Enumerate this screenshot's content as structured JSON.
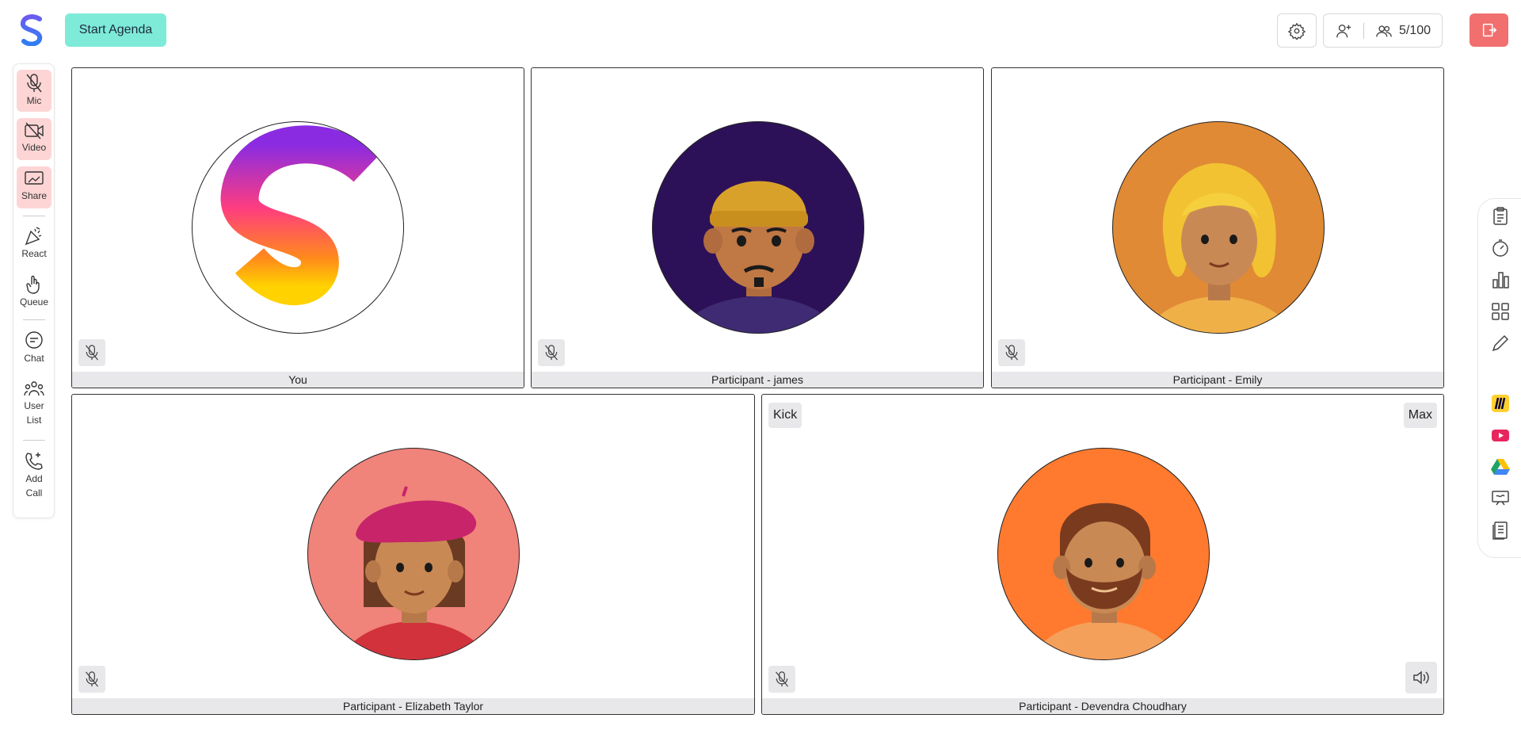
{
  "header": {
    "start_agenda_label": "Start Agenda",
    "participant_count": "5/100"
  },
  "sidebar": {
    "items": [
      {
        "label": "Mic",
        "icon": "mic-off-icon"
      },
      {
        "label": "Video",
        "icon": "video-off-icon"
      },
      {
        "label": "Share",
        "icon": "screen-share-icon"
      },
      {
        "label": "React",
        "icon": "party-popper-icon"
      },
      {
        "label": "Queue",
        "icon": "raise-hand-icon"
      },
      {
        "label": "Chat",
        "icon": "chat-bubble-icon"
      },
      {
        "label": "User List",
        "icon": "users-icon"
      },
      {
        "label": "Add Call",
        "icon": "phone-add-icon"
      }
    ]
  },
  "tiles": [
    {
      "name": "You",
      "avatar": "app-logo",
      "bg": "#ffffff"
    },
    {
      "name": "Participant - james",
      "avatar": "man-beanie",
      "bg": "#2d1158"
    },
    {
      "name": "Participant - Emily",
      "avatar": "woman-blonde",
      "bg": "#e08a35"
    },
    {
      "name": "Participant - Elizabeth Taylor",
      "avatar": "woman-beret",
      "bg": "#f0837a"
    },
    {
      "name": "Participant - Devendra Choudhary",
      "avatar": "man-beard",
      "bg": "#ff7a2e"
    }
  ],
  "tile_actions": {
    "kick_label": "Kick",
    "max_label": "Max"
  },
  "rightbar": {
    "icons": [
      "notes-icon",
      "timer-icon",
      "poll-chart-icon",
      "apps-grid-icon",
      "pencil-icon",
      "miro-icon",
      "youtube-icon",
      "google-drive-icon",
      "whiteboard-icon",
      "document-icon"
    ]
  },
  "colors": {
    "accent": "#7eead8",
    "danger": "#f16f6f",
    "muted_bg": "#e8e8ea"
  }
}
